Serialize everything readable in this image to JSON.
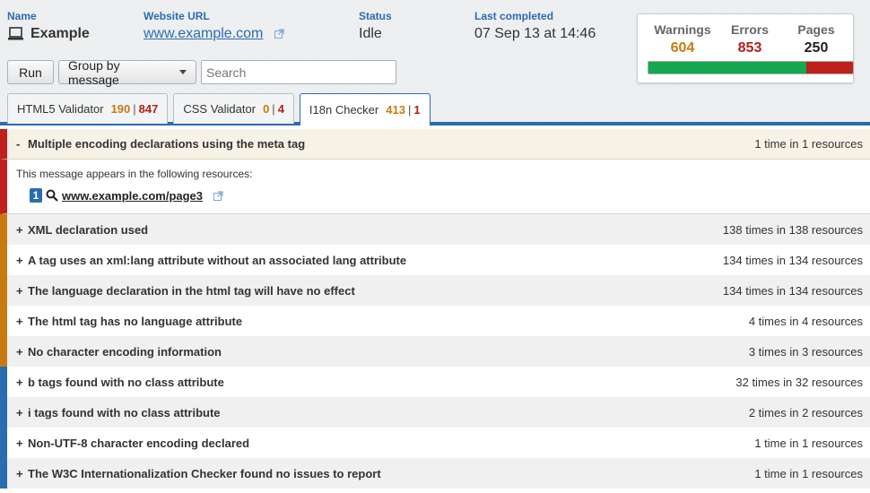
{
  "site": {
    "name_label": "Name",
    "name": "Example",
    "url_label": "Website URL",
    "url": "www.example.com",
    "status_label": "Status",
    "status": "Idle",
    "last_label": "Last completed",
    "last_completed": "07 Sep 13 at 14:46"
  },
  "stats": {
    "warnings_label": "Warnings",
    "warnings": "604",
    "errors_label": "Errors",
    "errors": "853",
    "pages_label": "Pages",
    "pages": "250",
    "pass_fraction": 0.77
  },
  "toolbar": {
    "run_label": "Run",
    "group_label": "Group by message",
    "search_placeholder": "Search"
  },
  "tabs": [
    {
      "label": "HTML5 Validator",
      "warnings": "190",
      "errors": "847"
    },
    {
      "label": "CSS Validator",
      "warnings": "0",
      "errors": "4"
    },
    {
      "label": "I18n Checker",
      "warnings": "413",
      "errors": "1"
    }
  ],
  "tab_separator": "|",
  "expanded": {
    "toggle": "-",
    "message": "Multiple encoding declarations using the meta tag",
    "count": "1 time in 1 resources",
    "detail_text": "This message appears in the following resources:",
    "resource_index": "1",
    "resource_url": "www.example.com/page3"
  },
  "messages": [
    {
      "toggle": "+",
      "message": "XML declaration used",
      "count": "138 times in 138 resources"
    },
    {
      "toggle": "+",
      "message": "A tag uses an xml:lang attribute without an associated lang attribute",
      "count": "134 times in 134 resources"
    },
    {
      "toggle": "+",
      "message": "The language declaration in the html tag will have no effect",
      "count": "134 times in 134 resources"
    },
    {
      "toggle": "+",
      "message": "The html tag has no language attribute",
      "count": "4 times in 4 resources"
    },
    {
      "toggle": "+",
      "message": "No character encoding information",
      "count": "3 times in 3 resources"
    },
    {
      "toggle": "+",
      "message": "b tags found with no class attribute",
      "count": "32 times in 32 resources"
    },
    {
      "toggle": "+",
      "message": "i tags found with no class attribute",
      "count": "2 times in 2 resources"
    },
    {
      "toggle": "+",
      "message": "Non-UTF-8 character encoding declared",
      "count": "1 time in 1 resources"
    },
    {
      "toggle": "+",
      "message": "The W3C Internationalization Checker found no issues to report",
      "count": "1 time in 1 resources"
    }
  ],
  "colors": {
    "warning": "#c87a10",
    "error": "#b0201c",
    "info": "#2a6cb0",
    "pass": "#14a850"
  }
}
